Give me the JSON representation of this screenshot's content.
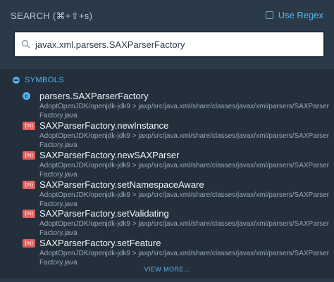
{
  "header": {
    "title": "SEARCH (⌘+⇧+s)",
    "use_regex_label": "Use Regex"
  },
  "search": {
    "value": "javax.xml.parsers.SAXParserFactory"
  },
  "results": {
    "section_label": "SYMBOLS",
    "items": [
      {
        "kind": "class",
        "badge": "c",
        "title": "parsers.SAXParserFactory",
        "path": "AdoptOpenJDK/openjdk-jdk9 > jaxp/src/java.xml/share/classes/javax/xml/parsers/SAXParserFactory.java"
      },
      {
        "kind": "method",
        "badge": "{m}",
        "title": "SAXParserFactory.newInstance",
        "path": "AdoptOpenJDK/openjdk-jdk9 > jaxp/src/java.xml/share/classes/javax/xml/parsers/SAXParserFactory.java"
      },
      {
        "kind": "method",
        "badge": "{m}",
        "title": "SAXParserFactory.newSAXParser",
        "path": "AdoptOpenJDK/openjdk-jdk9 > jaxp/src/java.xml/share/classes/javax/xml/parsers/SAXParserFactory.java"
      },
      {
        "kind": "method",
        "badge": "{m}",
        "title": "SAXParserFactory.setNamespaceAware",
        "path": "AdoptOpenJDK/openjdk-jdk9 > jaxp/src/java.xml/share/classes/javax/xml/parsers/SAXParserFactory.java"
      },
      {
        "kind": "method",
        "badge": "{m}",
        "title": "SAXParserFactory.setValidating",
        "path": "AdoptOpenJDK/openjdk-jdk9 > jaxp/src/java.xml/share/classes/javax/xml/parsers/SAXParserFactory.java"
      },
      {
        "kind": "method",
        "badge": "{m}",
        "title": "SAXParserFactory.setFeature",
        "path": "AdoptOpenJDK/openjdk-jdk9 > jaxp/src/java.xml/share/classes/javax/xml/parsers/SAXParserFactory.java"
      }
    ],
    "view_more_label": "VIEW MORE..."
  },
  "colors": {
    "accent": "#58b4f0",
    "method_badge": "#e05d5d",
    "background": "#2b3a48",
    "panel": "#23303c"
  }
}
